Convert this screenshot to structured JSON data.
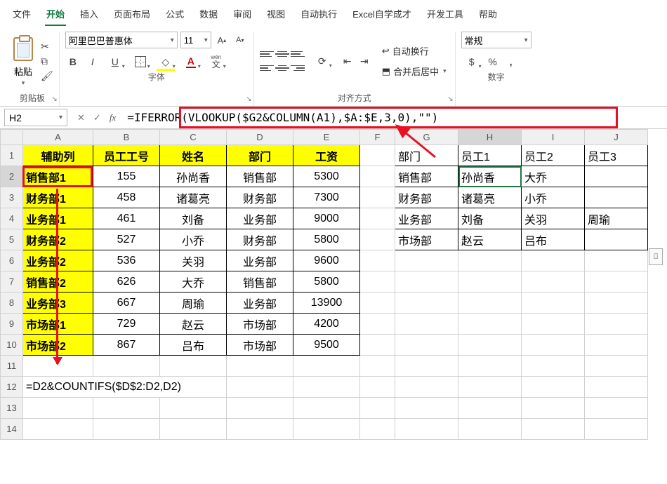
{
  "menu": {
    "file": "文件",
    "home": "开始",
    "insert": "插入",
    "layout": "页面布局",
    "formulas": "公式",
    "data": "数据",
    "review": "审阅",
    "view": "视图",
    "auto": "自动执行",
    "custom": "Excel自学成才",
    "dev": "开发工具",
    "help": "帮助"
  },
  "ribbon": {
    "paste_label": "粘贴",
    "clipboard_group": "剪贴板",
    "font_name": "阿里巴巴普惠体",
    "font_size": "11",
    "font_group": "字体",
    "wen_label": "wén",
    "wen_char": "文",
    "wrap_text": "自动换行",
    "merge_center": "合并后居中",
    "align_group": "对齐方式",
    "number_format": "常规",
    "number_group": "数字"
  },
  "name_box": "H2",
  "formula": "=IFERROR(VLOOKUP($G2&COLUMN(A1),$A:$E,3,0),\"\")",
  "formula_a12": "=D2&COUNTIFS($D$2:D2,D2)",
  "columns": [
    "A",
    "B",
    "C",
    "D",
    "E",
    "F",
    "G",
    "H",
    "I",
    "J"
  ],
  "headers_left": {
    "A": "辅助列",
    "B": "员工工号",
    "C": "姓名",
    "D": "部门",
    "E": "工资"
  },
  "headers_right": {
    "G": "部门",
    "H": "员工1",
    "I": "员工2",
    "J": "员工3"
  },
  "rows_left": [
    {
      "A": "销售部1",
      "B": "155",
      "C": "孙尚香",
      "D": "销售部",
      "E": "5300"
    },
    {
      "A": "财务部1",
      "B": "458",
      "C": "诸葛亮",
      "D": "财务部",
      "E": "7300"
    },
    {
      "A": "业务部1",
      "B": "461",
      "C": "刘备",
      "D": "业务部",
      "E": "9000"
    },
    {
      "A": "财务部2",
      "B": "527",
      "C": "小乔",
      "D": "财务部",
      "E": "5800"
    },
    {
      "A": "业务部2",
      "B": "536",
      "C": "关羽",
      "D": "业务部",
      "E": "9600"
    },
    {
      "A": "销售部2",
      "B": "626",
      "C": "大乔",
      "D": "销售部",
      "E": "5800"
    },
    {
      "A": "业务部3",
      "B": "667",
      "C": "周瑜",
      "D": "业务部",
      "E": "13900"
    },
    {
      "A": "市场部1",
      "B": "729",
      "C": "赵云",
      "D": "市场部",
      "E": "4200"
    },
    {
      "A": "市场部2",
      "B": "867",
      "C": "吕布",
      "D": "市场部",
      "E": "9500"
    }
  ],
  "rows_right": [
    {
      "G": "销售部",
      "H": "孙尚香",
      "I": "大乔",
      "J": ""
    },
    {
      "G": "财务部",
      "H": "诸葛亮",
      "I": "小乔",
      "J": ""
    },
    {
      "G": "业务部",
      "H": "刘备",
      "I": "关羽",
      "J": "周瑜"
    },
    {
      "G": "市场部",
      "H": "赵云",
      "I": "吕布",
      "J": ""
    }
  ]
}
